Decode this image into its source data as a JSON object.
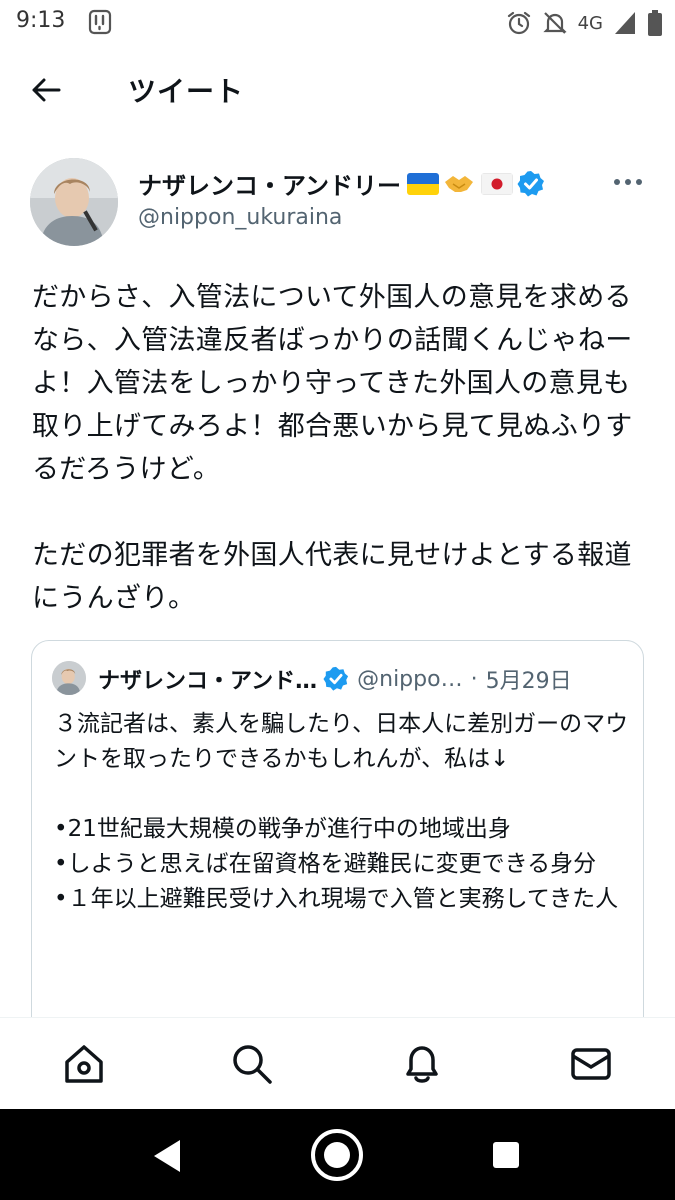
{
  "status_bar": {
    "time": "9:13",
    "network": "4G",
    "icons": [
      "app-notification-icon",
      "alarm-icon",
      "notifications-off-icon",
      "signal-icon",
      "battery-icon"
    ]
  },
  "header": {
    "title": "ツイート",
    "back_icon": "arrow-left-icon"
  },
  "tweet": {
    "author": {
      "display_name": "ナザレンコ・アンドリー",
      "handle": "@nippon_ukuraina",
      "verified": true,
      "emoji": [
        "ukraine-flag",
        "handshake",
        "japan-flag"
      ]
    },
    "text": "だからさ、入管法について外国人の意見を求めるなら、入管法違反者ばっかりの話聞くんじゃねーよ！入管法をしっかり守ってきた外国人の意見も取り上げてみろよ！都合悪いから見て見ぬふりするだろうけど。\n\nただの犯罪者を外国人代表に見せけよとする報道にうんざり。",
    "quote": {
      "display_name": "ナザレンコ・アンド…",
      "handle": "@nippo…",
      "separator": "·",
      "date": "5月29日",
      "text": "３流記者は、素人を騙したり、日本人に差別ガーのマウントを取ったりできるかもしれんが、私は↓\n\n•21世紀最大規模の戦争が進行中の地域出身\n•しようと思えば在留資格を避難民に変更できる身分\n•１年以上避難民受け入れ現場で入管と実務してきた人"
    }
  },
  "bottom_nav": {
    "items": [
      "home-icon",
      "search-icon",
      "notifications-icon",
      "messages-icon"
    ]
  },
  "system_nav": {
    "items": [
      "back-triangle-icon",
      "home-circle-icon",
      "recents-square-icon"
    ]
  },
  "colors": {
    "text": "#0f1419",
    "secondary": "#536471",
    "verified": "#1d9bf0",
    "border": "#cfd9de"
  }
}
